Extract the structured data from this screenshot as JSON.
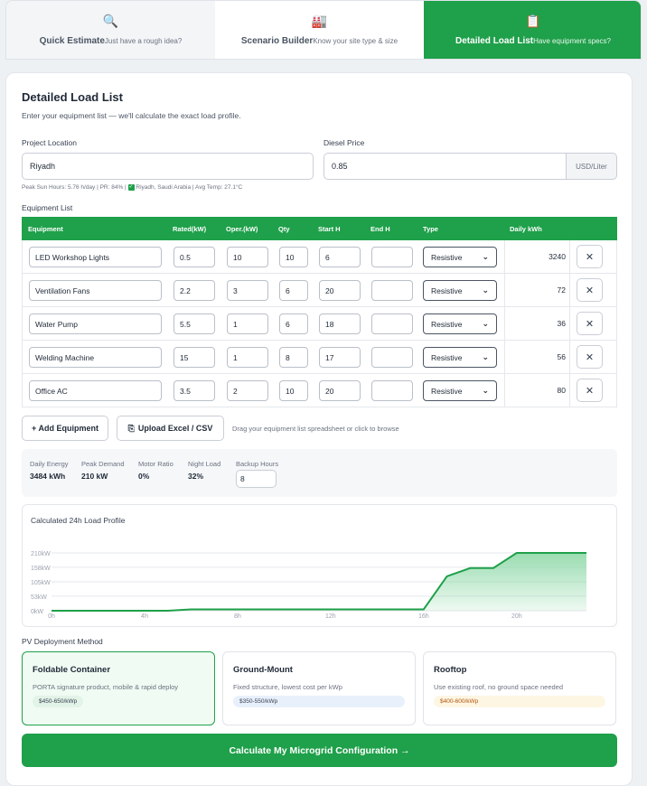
{
  "tabs": [
    {
      "icon": "🔍",
      "label": "Quick Estimate",
      "sub": "Just have a rough idea?"
    },
    {
      "icon": "🏭",
      "label": "Scenario Builder",
      "sub": "Know your site type & size"
    },
    {
      "icon": "📋",
      "label": "Detailed Load List",
      "sub": "Have equipment specs?"
    }
  ],
  "form": {
    "title": "Detailed Load List",
    "subtitle": "Enter your equipment list — we'll calculate the exact load profile.",
    "location_label": "Project Location",
    "location_value": "Riyadh",
    "diesel_label": "Diesel Price",
    "diesel_value": "0.85",
    "diesel_unit": "USD/Liter",
    "site_info_a": "Peak Sun Hours: 5.76 h/day | PR: 84% |",
    "site_info_b": "Riyadh, Saudi Arabia | Avg Temp: 27.1°C"
  },
  "equipment": {
    "section_label": "Equipment List",
    "headers": [
      "Equipment",
      "Rated(kW)",
      "Oper.(kW)",
      "Qty",
      "Start H",
      "End H",
      "Type",
      "Daily kWh"
    ],
    "rows": [
      {
        "name": "LED Workshop Lights",
        "rated": "0.5",
        "oper": "10",
        "qty": "10",
        "start": "6",
        "end": "",
        "type": "Resistive",
        "kwh": "3240"
      },
      {
        "name": "Ventilation Fans",
        "rated": "2.2",
        "oper": "3",
        "qty": "6",
        "start": "20",
        "end": "",
        "type": "Resistive",
        "kwh": "72"
      },
      {
        "name": "Water Pump",
        "rated": "5.5",
        "oper": "1",
        "qty": "6",
        "start": "18",
        "end": "",
        "type": "Resistive",
        "kwh": "36"
      },
      {
        "name": "Welding Machine",
        "rated": "15",
        "oper": "1",
        "qty": "8",
        "start": "17",
        "end": "",
        "type": "Resistive",
        "kwh": "56"
      },
      {
        "name": "Office AC",
        "rated": "3.5",
        "oper": "2",
        "qty": "10",
        "start": "20",
        "end": "",
        "type": "Resistive",
        "kwh": "80"
      }
    ],
    "add_label": "+ Add Equipment",
    "upload_label": "Upload Excel / CSV",
    "upload_hint": "Drag your equipment list spreadsheet or click to browse"
  },
  "stats": {
    "daily_energy_label": "Daily Energy",
    "daily_energy": "3484 kWh",
    "peak_label": "Peak Demand",
    "peak": "210 kW",
    "motor_label": "Motor Ratio",
    "motor": "0%",
    "night_label": "Night Load",
    "night": "32%",
    "backup_label": "Backup Hours",
    "backup": "8"
  },
  "chart_data": {
    "type": "area",
    "title": "Calculated 24h Load Profile",
    "y_tick_labels": [
      "0kW",
      "53kW",
      "105kW",
      "158kW",
      "210kW"
    ],
    "y_ticks": [
      0,
      53,
      105,
      158,
      210
    ],
    "x_tick_labels": [
      "0h",
      "4h",
      "8h",
      "12h",
      "16h",
      "20h"
    ],
    "x_ticks": [
      0,
      4,
      8,
      12,
      16,
      20
    ],
    "xlim": [
      0,
      23
    ],
    "ylim": [
      0,
      210
    ],
    "x": [
      0,
      1,
      2,
      3,
      4,
      5,
      6,
      7,
      8,
      9,
      10,
      11,
      12,
      13,
      14,
      15,
      16,
      17,
      18,
      19,
      20,
      21,
      22,
      23
    ],
    "values": [
      0,
      0,
      0,
      0,
      0,
      0,
      5,
      5,
      5,
      5,
      5,
      5,
      5,
      5,
      5,
      5,
      5,
      125,
      155,
      155,
      210,
      210,
      210,
      210
    ],
    "line_color": "#1fa04a",
    "fill_color": "#8fd9a8",
    "grid": true
  },
  "pv": {
    "section_label": "PV Deployment Method",
    "options": [
      {
        "title": "Foldable Container",
        "desc": "PORTA signature product, mobile & rapid deploy",
        "price": "$450-650/kWp",
        "pill_bg": "#e2f3e7",
        "pill_color": "#374151"
      },
      {
        "title": "Ground-Mount",
        "desc": "Fixed structure, lowest cost per kWp",
        "price": "$350-550/kWp",
        "pill_bg": "#e8f1fb",
        "pill_color": "#374151"
      },
      {
        "title": "Rooftop",
        "desc": "Use existing roof, no ground space needed",
        "price": "$400-600/kWp",
        "pill_bg": "#fdf6e3",
        "pill_color": "#b45309"
      }
    ]
  },
  "cta": "Calculate My Microgrid Configuration →",
  "colors": {
    "accent": "#1fa04a"
  }
}
